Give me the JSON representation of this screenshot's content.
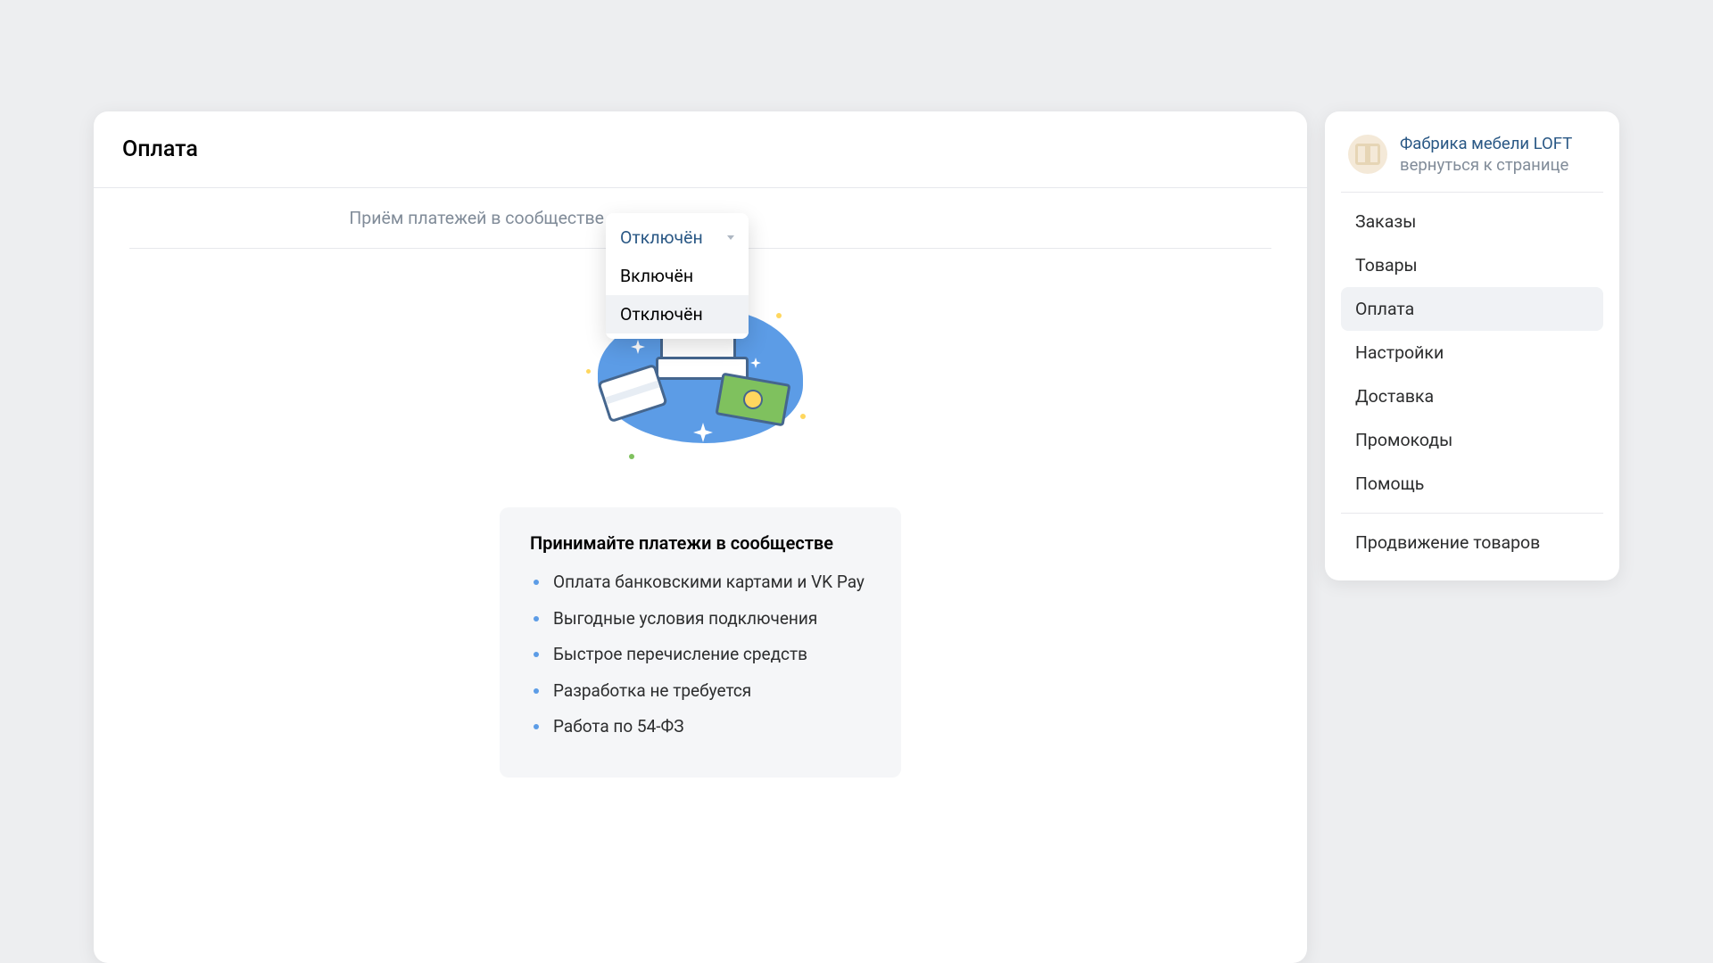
{
  "main": {
    "title": "Оплата",
    "form": {
      "label": "Приём платежей в сообществе",
      "selected": "Отключён",
      "options": [
        "Включён",
        "Отключён"
      ],
      "highlighted_index": 1
    },
    "info": {
      "heading": "Принимайте платежи в сообществе",
      "bullets": [
        "Оплата банковскими картами и VK Pay",
        "Выгодные условия подключения",
        "Быстрое перечисление средств",
        "Разработка не требуется",
        "Работа по 54-ФЗ"
      ]
    }
  },
  "sidebar": {
    "community_name": "Фабрика мебели LOFT",
    "back_text": "вернуться к странице",
    "items": [
      "Заказы",
      "Товары",
      "Оплата",
      "Настройки",
      "Доставка",
      "Промокоды",
      "Помощь"
    ],
    "active_index": 2,
    "footer_item": "Продвижение товаров"
  }
}
